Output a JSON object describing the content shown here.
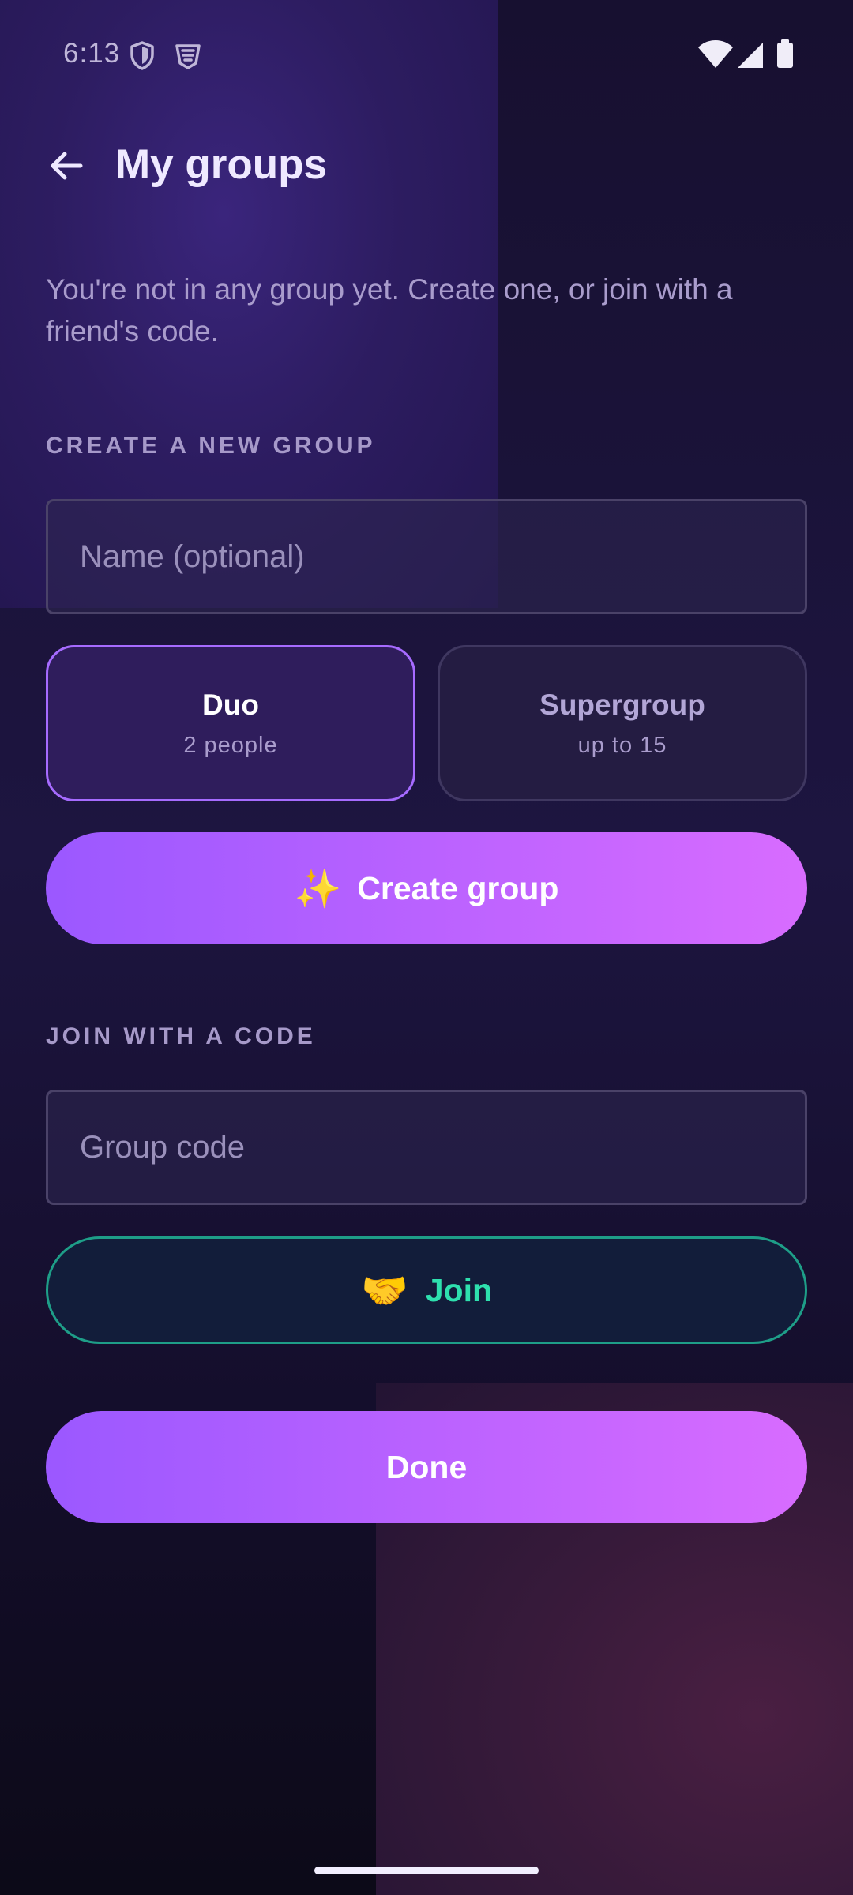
{
  "status_bar": {
    "time": "6:13",
    "left_icons": [
      "shield-icon",
      "vpn-badge-icon"
    ],
    "right_icons": [
      "wifi-icon",
      "signal-icon",
      "battery-icon"
    ]
  },
  "header": {
    "back_icon": "arrow-left-icon",
    "title": "My groups"
  },
  "intro_text": "You're not in any group yet. Create one, or join with a friend's code.",
  "create_section": {
    "label": "CREATE A NEW GROUP",
    "name_input": {
      "value": "",
      "placeholder": "Name (optional)"
    },
    "options": [
      {
        "title": "Duo",
        "subtitle": "2 people",
        "selected": true
      },
      {
        "title": "Supergroup",
        "subtitle": "up to 15",
        "selected": false
      }
    ],
    "create_button": {
      "icon": "✨",
      "label": "Create group"
    }
  },
  "join_section": {
    "label": "JOIN WITH A CODE",
    "code_input": {
      "value": "",
      "placeholder": "Group code"
    },
    "join_button": {
      "icon": "🤝",
      "label": "Join"
    }
  },
  "done_button": {
    "label": "Done"
  },
  "colors": {
    "background": "#150f2a",
    "accent_purple": "#a66bff",
    "button_gradient_start": "#9b58ff",
    "button_gradient_end": "#d86cff",
    "join_accent": "#2ee0ae"
  }
}
